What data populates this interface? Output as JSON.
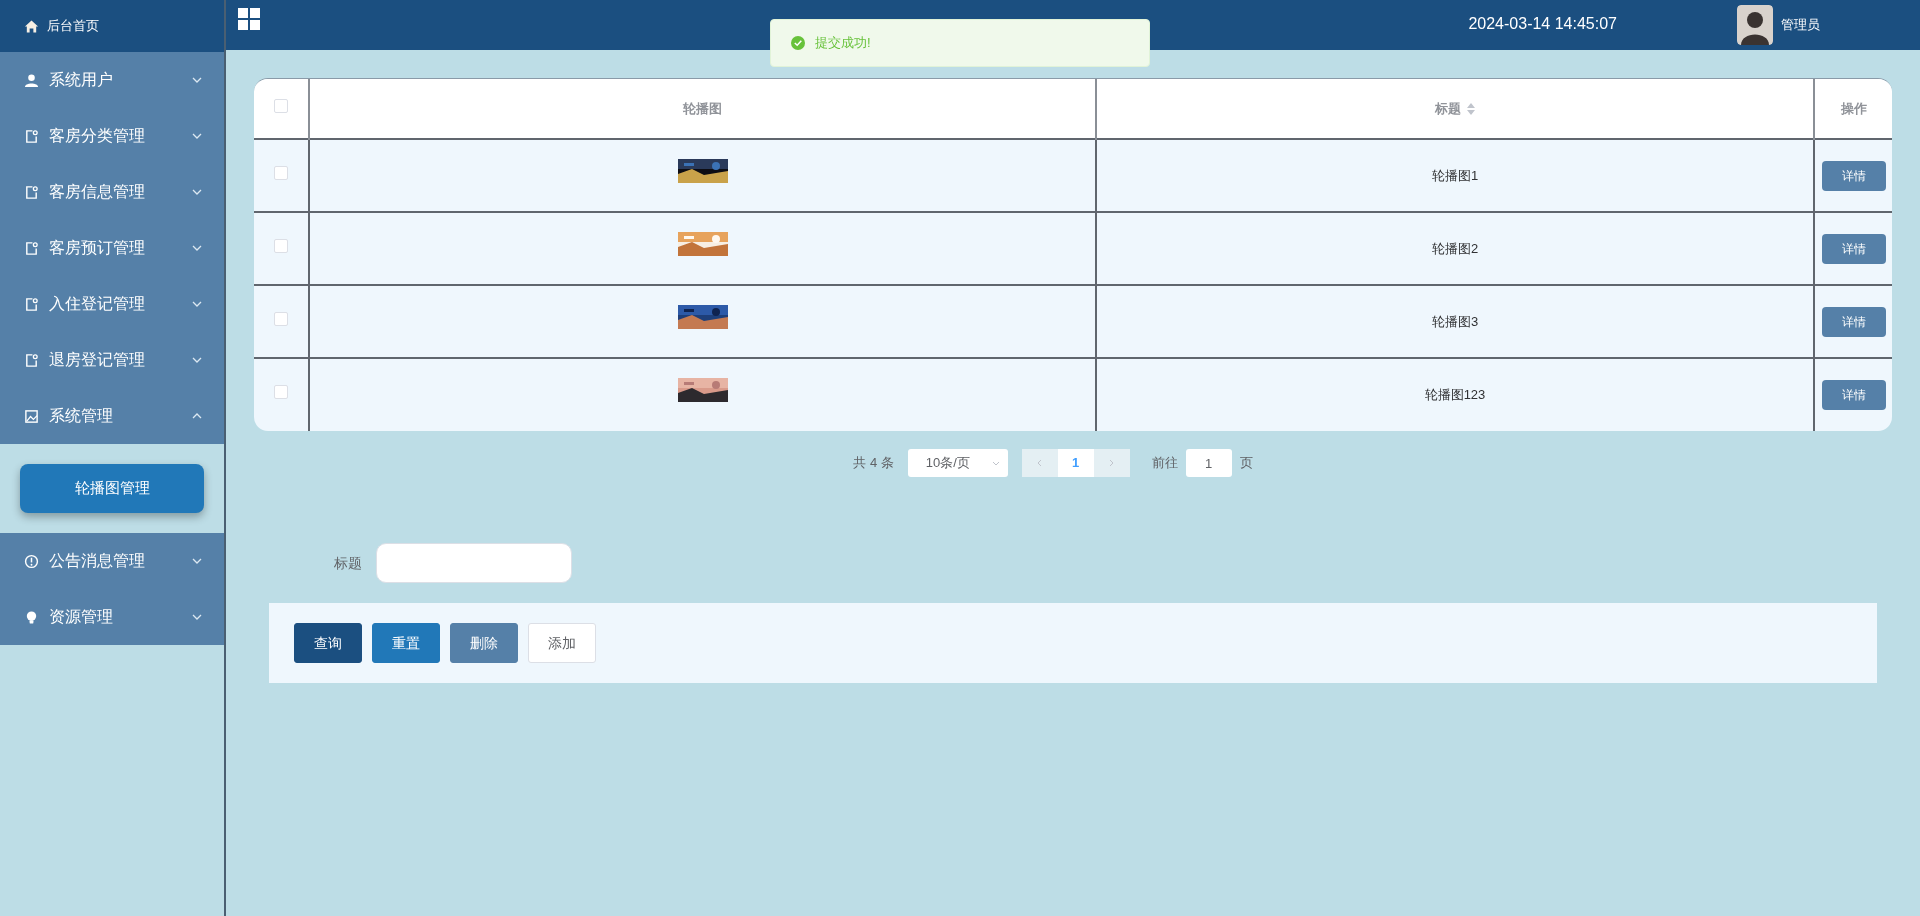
{
  "sidebar": {
    "home": {
      "label": "后台首页"
    },
    "items": [
      {
        "label": "系统用户",
        "expanded": false
      },
      {
        "label": "客房分类管理",
        "expanded": false
      },
      {
        "label": "客房信息管理",
        "expanded": false
      },
      {
        "label": "客房预订管理",
        "expanded": false
      },
      {
        "label": "入住登记管理",
        "expanded": false
      },
      {
        "label": "退房登记管理",
        "expanded": false
      },
      {
        "label": "系统管理",
        "expanded": true,
        "children": [
          {
            "label": "轮播图管理",
            "selected": true
          }
        ]
      },
      {
        "label": "公告消息管理",
        "expanded": false
      },
      {
        "label": "资源管理",
        "expanded": false
      }
    ]
  },
  "header": {
    "datetime": "2024-03-14 14:45:07",
    "user": "管理员"
  },
  "toast": {
    "message": "提交成功!"
  },
  "table": {
    "columns": [
      "轮播图",
      "标题",
      "操作"
    ],
    "rows": [
      {
        "checked": false,
        "title": "轮播图1",
        "action": "详情"
      },
      {
        "checked": false,
        "title": "轮播图2",
        "action": "详情"
      },
      {
        "checked": false,
        "title": "轮播图3",
        "action": "详情"
      },
      {
        "checked": false,
        "title": "轮播图123",
        "action": "详情"
      }
    ],
    "all_checked": false
  },
  "pagination": {
    "total": "共 4 条",
    "page_size": "10条/页",
    "pages": [
      {
        "label": "1",
        "selected": true
      }
    ],
    "goto_label": "前往",
    "goto_value": "1",
    "goto_suffix": "页"
  },
  "search": {
    "label": "标题"
  },
  "buttons": [
    {
      "label": "查询",
      "kind": "primary"
    },
    {
      "label": "重置",
      "kind": "accent"
    },
    {
      "label": "删除",
      "kind": "muted"
    },
    {
      "label": "添加",
      "kind": "plain"
    }
  ]
}
